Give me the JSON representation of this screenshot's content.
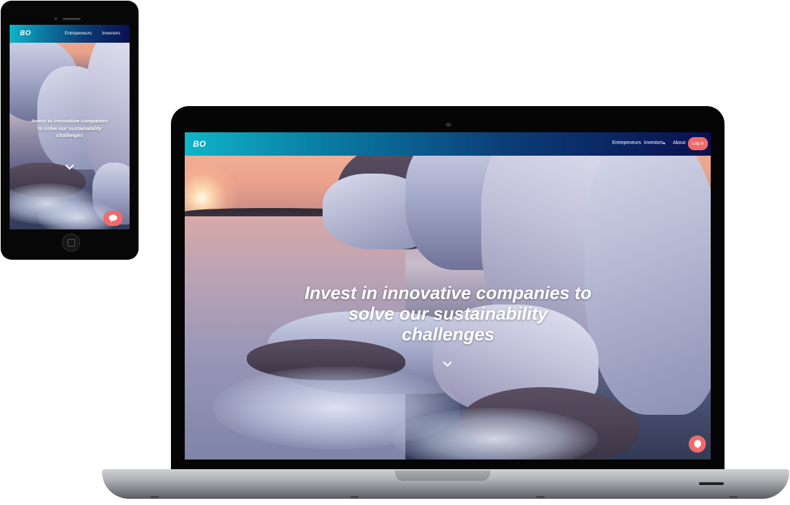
{
  "brand": {
    "logo": "BO"
  },
  "phone": {
    "nav": {
      "entrepreneurs": "Entrepeneurs",
      "investors": "Investors"
    },
    "hero_text": "Invest in innovative companies to solve our sustainability challenges"
  },
  "laptop": {
    "nav": {
      "entrepreneurs": "Entrepeneurs",
      "investors": "Investors",
      "about": "About",
      "login": "Log in"
    },
    "hero_text": "Invest in innovative companies to solve our sustainability challenges"
  },
  "colors": {
    "nav_gradient_start": "#10b4c8",
    "nav_gradient_end": "#0a1050",
    "accent": "#ef6a6b"
  },
  "icons": [
    "chevron-down-icon",
    "chat-bubble-icon"
  ]
}
